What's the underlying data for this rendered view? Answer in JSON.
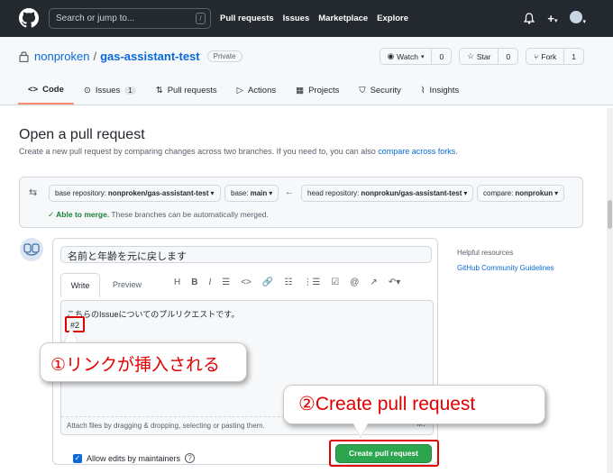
{
  "topnav": {
    "search_placeholder": "Search or jump to...",
    "slash_key": "/",
    "links": [
      "Pull requests",
      "Issues",
      "Marketplace",
      "Explore"
    ],
    "plus": "+",
    "caret": "▾",
    "bell_icon": "bell-icon"
  },
  "repo": {
    "owner": "nonproken",
    "separator": "/",
    "name": "gas-assistant-test",
    "visibility": "Private",
    "watch_label": "Watch",
    "watch_count": "0",
    "star_label": "Star",
    "star_count": "0",
    "fork_label": "Fork",
    "fork_count": "1"
  },
  "tabs": [
    {
      "label": "Code",
      "icon": "<>"
    },
    {
      "label": "Issues",
      "icon": "⊙",
      "count": "1"
    },
    {
      "label": "Pull requests",
      "icon": "⇅"
    },
    {
      "label": "Actions",
      "icon": "▷"
    },
    {
      "label": "Projects",
      "icon": "▦"
    },
    {
      "label": "Security",
      "icon": "⛉"
    },
    {
      "label": "Insights",
      "icon": "⌇"
    }
  ],
  "page": {
    "title": "Open a pull request",
    "subtitle": "Create a new pull request by comparing changes across two branches. If you need to, you can also ",
    "subtitle_link": "compare across forks",
    "subtitle_end": "."
  },
  "compare": {
    "base_repo_label": "base repository: ",
    "base_repo_value": "nonproken/gas-assistant-test",
    "base_label": "base: ",
    "base_value": "main",
    "head_repo_label": "head repository: ",
    "head_repo_value": "nonprokun/gas-assistant-test",
    "compare_label": "compare: ",
    "compare_value": "nonprokun",
    "merge_ok": "Able to merge.",
    "merge_note": " These branches can be automatically merged."
  },
  "pr": {
    "title_value": "名前と年齢を元に戻します",
    "write_tab": "Write",
    "preview_tab": "Preview",
    "toolbar": [
      "H",
      "B",
      "I",
      "☰",
      "<>",
      "🔗",
      "☷",
      "⋮☰",
      "☑",
      "@",
      "↗",
      "↶▾"
    ],
    "body_line": "こちらのIssueについてのプルリクエストです。",
    "issue_ref": "#2",
    "attach_text": "Attach files by dragging & dropping, selecting or pasting them.",
    "allow_label": "Allow edits by maintainers",
    "create_button": "Create pull request"
  },
  "sidebar": {
    "helpful": "Helpful resources",
    "guidelines": "GitHub Community Guidelines"
  },
  "annotations": {
    "callout1": "①リンクが挿入される",
    "callout2": "②Create pull request"
  }
}
